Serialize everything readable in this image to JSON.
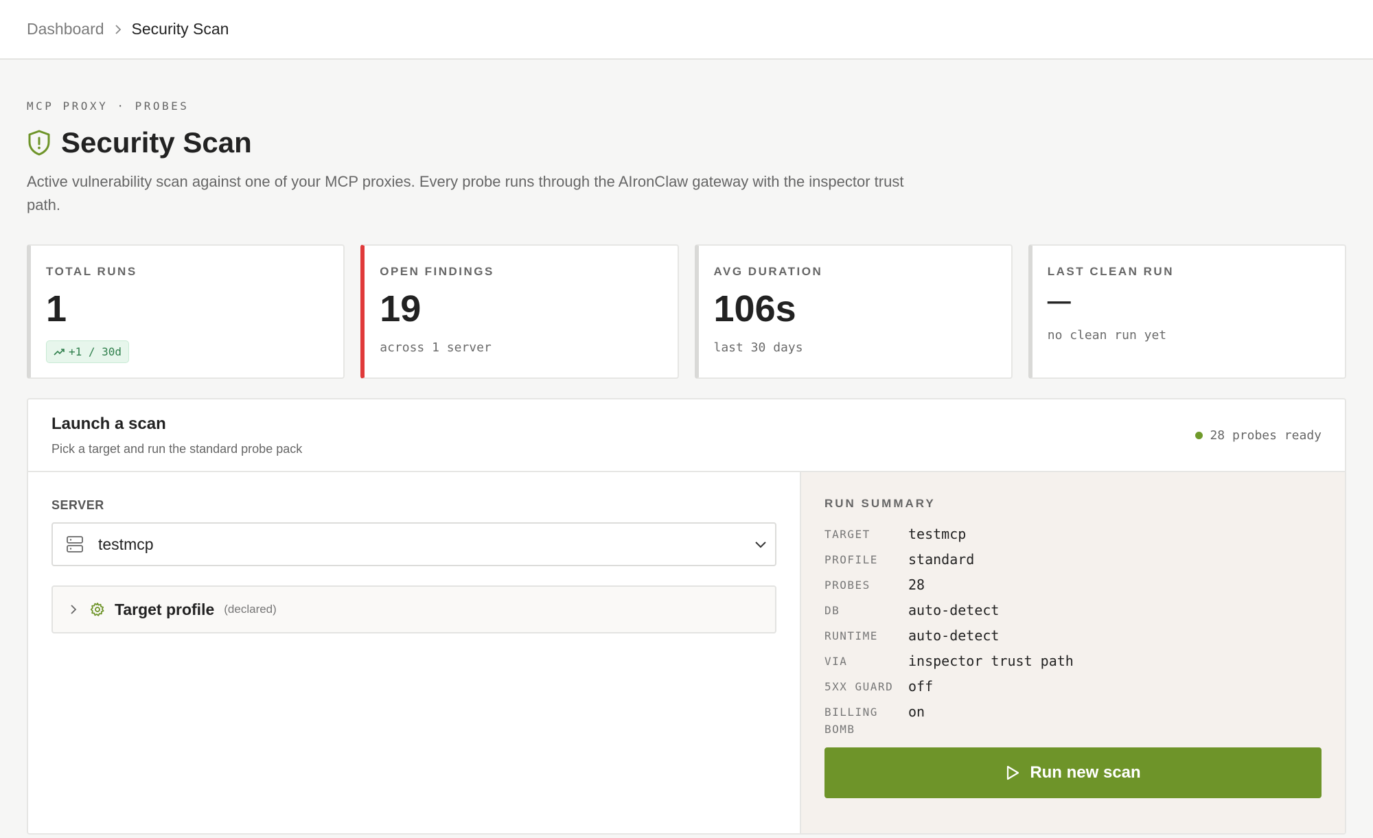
{
  "breadcrumb": {
    "parent": "Dashboard",
    "current": "Security Scan"
  },
  "header": {
    "eyebrow": "MCP PROXY · PROBES",
    "title": "Security Scan",
    "description": "Active vulnerability scan against one of your MCP proxies. Every probe runs through the AIronClaw gateway with the inspector trust path."
  },
  "stats": [
    {
      "label": "TOTAL RUNS",
      "value": "1",
      "trend": "+1 / 30d"
    },
    {
      "label": "OPEN FINDINGS",
      "value": "19",
      "sub": "across 1 server"
    },
    {
      "label": "AVG DURATION",
      "value": "106s",
      "sub": "last 30 days"
    },
    {
      "label": "LAST CLEAN RUN",
      "value": "—",
      "sub": "no clean run yet"
    }
  ],
  "launch": {
    "title": "Launch a scan",
    "subtitle": "Pick a target and run the standard probe pack",
    "ready": "28 probes ready",
    "server_label": "SERVER",
    "server_value": "testmcp",
    "profile_title": "Target profile",
    "profile_note": "(declared)"
  },
  "summary": {
    "title": "RUN SUMMARY",
    "rows": [
      {
        "key": "TARGET",
        "value": "testmcp"
      },
      {
        "key": "PROFILE",
        "value": "standard"
      },
      {
        "key": "PROBES",
        "value": "28"
      },
      {
        "key": "DB",
        "value": "auto-detect"
      },
      {
        "key": "RUNTIME",
        "value": "auto-detect"
      },
      {
        "key": "VIA",
        "value": "inspector trust path"
      },
      {
        "key": "5XX GUARD",
        "value": "off"
      },
      {
        "key": "BILLING BOMB",
        "value": "on"
      }
    ],
    "button": "Run new scan"
  },
  "colors": {
    "accent": "#6e9429",
    "alert": "#e03a3a",
    "success": "#2f7f4c"
  },
  "icons": [
    "chevron-right-icon",
    "shield-icon",
    "trend-up-icon",
    "server-icon",
    "chevron-down-icon",
    "gear-icon",
    "play-icon"
  ]
}
